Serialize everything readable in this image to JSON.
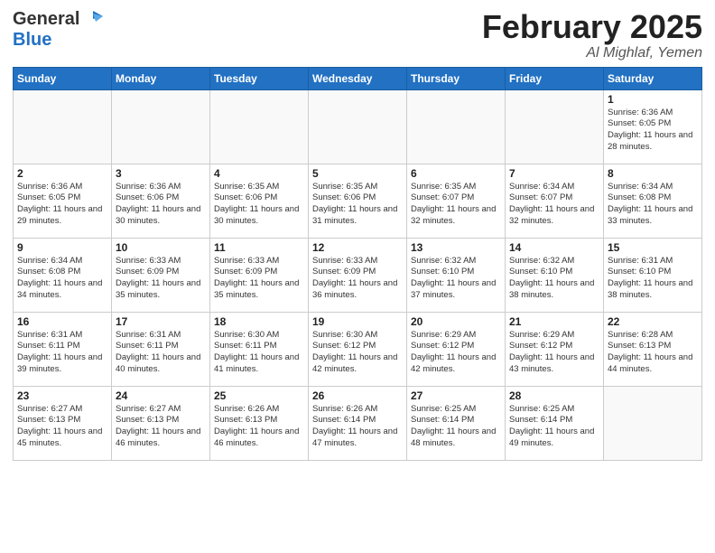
{
  "header": {
    "logo_general": "General",
    "logo_blue": "Blue",
    "title": "February 2025",
    "location": "Al Mighlaf, Yemen"
  },
  "weekdays": [
    "Sunday",
    "Monday",
    "Tuesday",
    "Wednesday",
    "Thursday",
    "Friday",
    "Saturday"
  ],
  "weeks": [
    [
      {
        "day": "",
        "info": ""
      },
      {
        "day": "",
        "info": ""
      },
      {
        "day": "",
        "info": ""
      },
      {
        "day": "",
        "info": ""
      },
      {
        "day": "",
        "info": ""
      },
      {
        "day": "",
        "info": ""
      },
      {
        "day": "1",
        "info": "Sunrise: 6:36 AM\nSunset: 6:05 PM\nDaylight: 11 hours and 28 minutes."
      }
    ],
    [
      {
        "day": "2",
        "info": "Sunrise: 6:36 AM\nSunset: 6:05 PM\nDaylight: 11 hours and 29 minutes."
      },
      {
        "day": "3",
        "info": "Sunrise: 6:36 AM\nSunset: 6:06 PM\nDaylight: 11 hours and 30 minutes."
      },
      {
        "day": "4",
        "info": "Sunrise: 6:35 AM\nSunset: 6:06 PM\nDaylight: 11 hours and 30 minutes."
      },
      {
        "day": "5",
        "info": "Sunrise: 6:35 AM\nSunset: 6:06 PM\nDaylight: 11 hours and 31 minutes."
      },
      {
        "day": "6",
        "info": "Sunrise: 6:35 AM\nSunset: 6:07 PM\nDaylight: 11 hours and 32 minutes."
      },
      {
        "day": "7",
        "info": "Sunrise: 6:34 AM\nSunset: 6:07 PM\nDaylight: 11 hours and 32 minutes."
      },
      {
        "day": "8",
        "info": "Sunrise: 6:34 AM\nSunset: 6:08 PM\nDaylight: 11 hours and 33 minutes."
      }
    ],
    [
      {
        "day": "9",
        "info": "Sunrise: 6:34 AM\nSunset: 6:08 PM\nDaylight: 11 hours and 34 minutes."
      },
      {
        "day": "10",
        "info": "Sunrise: 6:33 AM\nSunset: 6:09 PM\nDaylight: 11 hours and 35 minutes."
      },
      {
        "day": "11",
        "info": "Sunrise: 6:33 AM\nSunset: 6:09 PM\nDaylight: 11 hours and 35 minutes."
      },
      {
        "day": "12",
        "info": "Sunrise: 6:33 AM\nSunset: 6:09 PM\nDaylight: 11 hours and 36 minutes."
      },
      {
        "day": "13",
        "info": "Sunrise: 6:32 AM\nSunset: 6:10 PM\nDaylight: 11 hours and 37 minutes."
      },
      {
        "day": "14",
        "info": "Sunrise: 6:32 AM\nSunset: 6:10 PM\nDaylight: 11 hours and 38 minutes."
      },
      {
        "day": "15",
        "info": "Sunrise: 6:31 AM\nSunset: 6:10 PM\nDaylight: 11 hours and 38 minutes."
      }
    ],
    [
      {
        "day": "16",
        "info": "Sunrise: 6:31 AM\nSunset: 6:11 PM\nDaylight: 11 hours and 39 minutes."
      },
      {
        "day": "17",
        "info": "Sunrise: 6:31 AM\nSunset: 6:11 PM\nDaylight: 11 hours and 40 minutes."
      },
      {
        "day": "18",
        "info": "Sunrise: 6:30 AM\nSunset: 6:11 PM\nDaylight: 11 hours and 41 minutes."
      },
      {
        "day": "19",
        "info": "Sunrise: 6:30 AM\nSunset: 6:12 PM\nDaylight: 11 hours and 42 minutes."
      },
      {
        "day": "20",
        "info": "Sunrise: 6:29 AM\nSunset: 6:12 PM\nDaylight: 11 hours and 42 minutes."
      },
      {
        "day": "21",
        "info": "Sunrise: 6:29 AM\nSunset: 6:12 PM\nDaylight: 11 hours and 43 minutes."
      },
      {
        "day": "22",
        "info": "Sunrise: 6:28 AM\nSunset: 6:13 PM\nDaylight: 11 hours and 44 minutes."
      }
    ],
    [
      {
        "day": "23",
        "info": "Sunrise: 6:27 AM\nSunset: 6:13 PM\nDaylight: 11 hours and 45 minutes."
      },
      {
        "day": "24",
        "info": "Sunrise: 6:27 AM\nSunset: 6:13 PM\nDaylight: 11 hours and 46 minutes."
      },
      {
        "day": "25",
        "info": "Sunrise: 6:26 AM\nSunset: 6:13 PM\nDaylight: 11 hours and 46 minutes."
      },
      {
        "day": "26",
        "info": "Sunrise: 6:26 AM\nSunset: 6:14 PM\nDaylight: 11 hours and 47 minutes."
      },
      {
        "day": "27",
        "info": "Sunrise: 6:25 AM\nSunset: 6:14 PM\nDaylight: 11 hours and 48 minutes."
      },
      {
        "day": "28",
        "info": "Sunrise: 6:25 AM\nSunset: 6:14 PM\nDaylight: 11 hours and 49 minutes."
      },
      {
        "day": "",
        "info": ""
      }
    ]
  ]
}
